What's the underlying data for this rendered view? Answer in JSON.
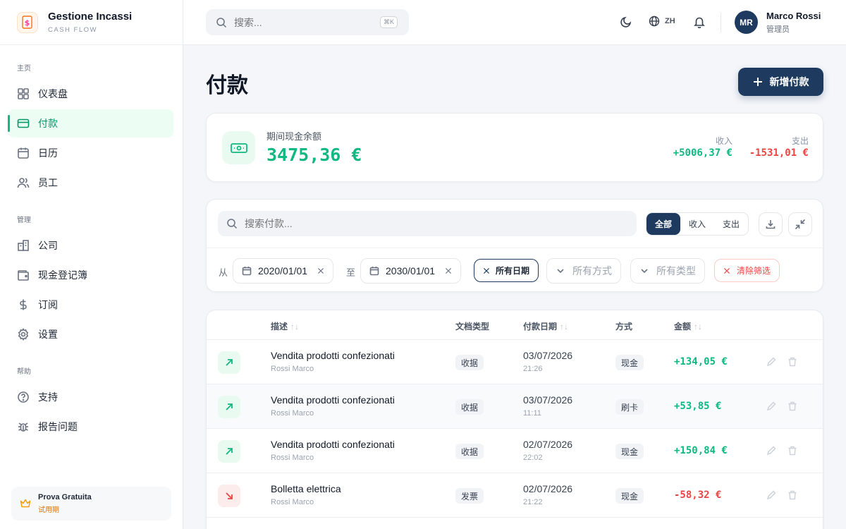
{
  "brand": {
    "title": "Gestione Incassi",
    "subtitle": "CASH FLOW"
  },
  "sidebar": {
    "sections": [
      {
        "label": "主页",
        "items": [
          {
            "label": "仪表盘",
            "icon": "dashboard-icon"
          },
          {
            "label": "付款",
            "icon": "card-icon",
            "active": true
          },
          {
            "label": "日历",
            "icon": "calendar-icon"
          },
          {
            "label": "员工",
            "icon": "users-icon"
          }
        ]
      },
      {
        "label": "管理",
        "items": [
          {
            "label": "公司",
            "icon": "building-icon"
          },
          {
            "label": "现金登记簿",
            "icon": "wallet-icon"
          },
          {
            "label": "订阅",
            "icon": "dollar-icon"
          },
          {
            "label": "设置",
            "icon": "gear-icon"
          }
        ]
      },
      {
        "label": "帮助",
        "items": [
          {
            "label": "支持",
            "icon": "help-icon"
          },
          {
            "label": "报告问题",
            "icon": "bug-icon"
          }
        ]
      }
    ],
    "trial": {
      "title": "Prova Gratuita",
      "status": "试用期"
    }
  },
  "topbar": {
    "search_placeholder": "搜索...",
    "shortcut": "⌘K",
    "lang": "ZH",
    "user": {
      "initials": "MR",
      "name": "Marco Rossi",
      "role": "管理员"
    }
  },
  "page": {
    "title": "付款",
    "new_button": "新增付款"
  },
  "balance": {
    "label": "期间现金余额",
    "value": "3475,36 €",
    "income_label": "收入",
    "income_value": "+5006,37 €",
    "expense_label": "支出",
    "expense_value": "-1531,01 €"
  },
  "filters": {
    "search_placeholder": "搜索付款...",
    "segments": [
      "全部",
      "收入",
      "支出"
    ],
    "selected_segment": "全部",
    "from_label": "从",
    "from_date": "2020/01/01",
    "to_label": "至",
    "to_date": "2030/01/01",
    "all_dates": "所有日期",
    "all_methods": "所有方式",
    "all_types": "所有类型",
    "clear": "清除筛选"
  },
  "table": {
    "columns": {
      "description": "描述",
      "doc_type": "文档类型",
      "date": "付款日期",
      "method": "方式",
      "amount": "金额"
    },
    "sort_glyph": "↑↓",
    "rows": [
      {
        "direction": "in",
        "description": "Vendita prodotti confezionati",
        "person": "Rossi Marco",
        "doc_type": "收据",
        "date": "03/07/2026",
        "time": "21:26",
        "method": "现金",
        "amount": "+134,05 €"
      },
      {
        "direction": "in",
        "description": "Vendita prodotti confezionati",
        "person": "Rossi Marco",
        "doc_type": "收据",
        "date": "03/07/2026",
        "time": "11:11",
        "method": "刷卡",
        "amount": "+53,85 €"
      },
      {
        "direction": "in",
        "description": "Vendita prodotti confezionati",
        "person": "Rossi Marco",
        "doc_type": "收据",
        "date": "02/07/2026",
        "time": "22:02",
        "method": "现金",
        "amount": "+150,84 €"
      },
      {
        "direction": "out",
        "description": "Bolletta elettrica",
        "person": "Rossi Marco",
        "doc_type": "发票",
        "date": "02/07/2026",
        "time": "21:22",
        "method": "现金",
        "amount": "-58,32 €"
      }
    ]
  }
}
